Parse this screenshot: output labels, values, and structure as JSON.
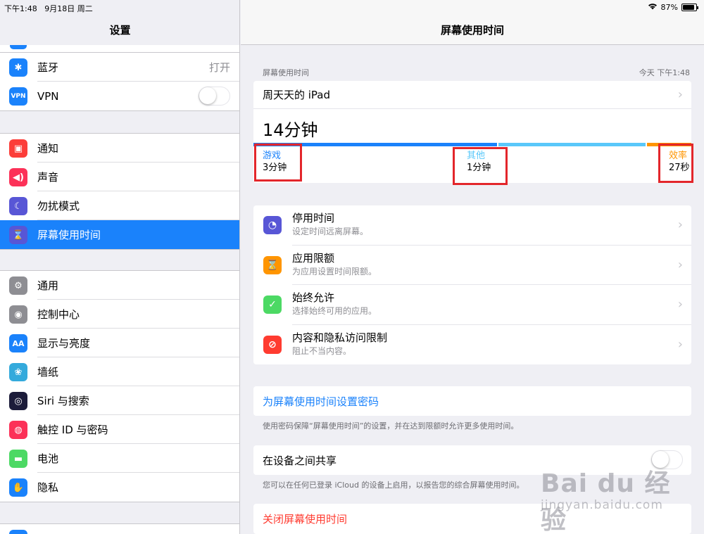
{
  "status": {
    "time": "下午1:48",
    "date": "9月18日 周二",
    "battery": "87%"
  },
  "sidebar": {
    "title": "设置",
    "group1": [
      {
        "label": "蓝牙",
        "value": "打开",
        "icon": "bluetooth-icon",
        "color": "#1a82fb",
        "glyph": "✱"
      },
      {
        "label": "VPN",
        "icon": "vpn-icon",
        "color": "#1a82fb",
        "glyph": "VPN",
        "toggle": "off"
      }
    ],
    "group2": [
      {
        "label": "通知",
        "icon": "notifications-icon",
        "color": "#fc3d39",
        "glyph": "▣"
      },
      {
        "label": "声音",
        "icon": "sound-icon",
        "color": "#fc3158",
        "glyph": "◀)"
      },
      {
        "label": "勿扰模式",
        "icon": "moon-icon",
        "color": "#5856d6",
        "glyph": "☾"
      },
      {
        "label": "屏幕使用时间",
        "icon": "hourglass-icon",
        "color": "#5856d6",
        "glyph": "⌛",
        "selected": true
      }
    ],
    "group3": [
      {
        "label": "通用",
        "icon": "gear-icon",
        "color": "#8e8e93",
        "glyph": "⚙"
      },
      {
        "label": "控制中心",
        "icon": "control-center-icon",
        "color": "#8e8e93",
        "glyph": "◉"
      },
      {
        "label": "显示与亮度",
        "icon": "display-icon",
        "color": "#1a82fb",
        "glyph": "AA"
      },
      {
        "label": "墙纸",
        "icon": "wallpaper-icon",
        "color": "#34aadc",
        "glyph": "❀"
      },
      {
        "label": "Siri 与搜索",
        "icon": "siri-icon",
        "color": "#1c1c3a",
        "glyph": "◎"
      },
      {
        "label": "触控 ID 与密码",
        "icon": "fingerprint-icon",
        "color": "#fc3158",
        "glyph": "◍"
      },
      {
        "label": "电池",
        "icon": "battery-icon",
        "color": "#4cd964",
        "glyph": "▬"
      },
      {
        "label": "隐私",
        "icon": "hand-icon",
        "color": "#1a82fb",
        "glyph": "✋"
      }
    ]
  },
  "main": {
    "title": "屏幕使用时间",
    "section_header": "屏幕使用时间",
    "section_header_right": "今天 下午1:48",
    "device": "周天天的 iPad",
    "total": "14分钟",
    "categories": [
      {
        "name": "游戏",
        "time": "3分钟",
        "color": "#1a82fb",
        "minutes": 3
      },
      {
        "name": "其他",
        "time": "1分钟",
        "color": "#5ac8fa",
        "minutes": 1
      },
      {
        "name": "效率",
        "time": "27秒",
        "color": "#ff9500",
        "minutes": 0.45
      }
    ],
    "list": [
      {
        "title": "停用时间",
        "subtitle": "设定时间远离屏幕。",
        "icon": "downtime-icon",
        "color": "#5856d6",
        "glyph": "◔"
      },
      {
        "title": "应用限额",
        "subtitle": "为应用设置时间限额。",
        "icon": "app-limits-icon",
        "color": "#ff9500",
        "glyph": "⌛"
      },
      {
        "title": "始终允许",
        "subtitle": "选择始终可用的应用。",
        "icon": "always-allowed-icon",
        "color": "#4cd964",
        "glyph": "✓"
      },
      {
        "title": "内容和隐私访问限制",
        "subtitle": "阻止不当内容。",
        "icon": "restrictions-icon",
        "color": "#ff3b30",
        "glyph": "⊘"
      }
    ],
    "passcode_link": "为屏幕使用时间设置密码",
    "passcode_footer": "使用密码保障“屏幕使用时间”的设置，并在达到限额时允许更多使用时间。",
    "share_label": "在设备之间共享",
    "share_footer": "您可以在任何已登录 iCloud 的设备上启用，以报告您的综合屏幕使用时间。",
    "turn_off": "关闭屏幕使用时间"
  },
  "watermark": {
    "line1": "Bai du 经验",
    "line2": "jingyan.baidu.com"
  }
}
